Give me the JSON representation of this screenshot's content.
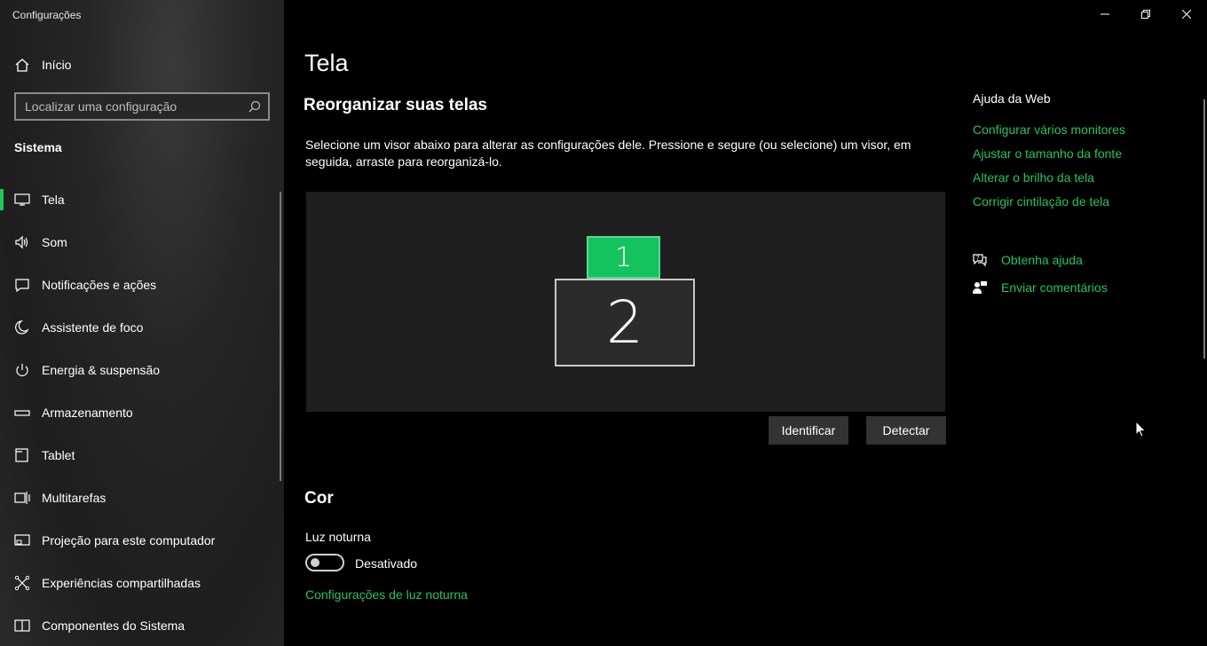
{
  "window": {
    "title": "Configurações",
    "controls": {
      "minimize": "minimize-icon",
      "maximize": "restore-icon",
      "close": "close-icon"
    }
  },
  "sidebar": {
    "home_label": "Início",
    "search_placeholder": "Localizar uma configuração",
    "section": "Sistema",
    "items": [
      {
        "label": "Tela",
        "icon": "monitor-icon",
        "active": true
      },
      {
        "label": "Som",
        "icon": "speaker-icon"
      },
      {
        "label": "Notificações e ações",
        "icon": "notification-icon"
      },
      {
        "label": "Assistente de foco",
        "icon": "moon-icon"
      },
      {
        "label": "Energia & suspensão",
        "icon": "power-icon"
      },
      {
        "label": "Armazenamento",
        "icon": "storage-icon"
      },
      {
        "label": "Tablet",
        "icon": "tablet-icon"
      },
      {
        "label": "Multitarefas",
        "icon": "multitasking-icon"
      },
      {
        "label": "Projeção para este computador",
        "icon": "projection-icon"
      },
      {
        "label": "Experiências compartilhadas",
        "icon": "shared-icon"
      },
      {
        "label": "Componentes do Sistema",
        "icon": "components-icon"
      }
    ]
  },
  "main": {
    "title": "Tela",
    "rearrange": {
      "heading": "Reorganizar suas telas",
      "description": "Selecione um visor abaixo para alterar as configurações dele. Pressione e segure (ou selecione) um visor, em seguida, arraste para reorganizá-lo.",
      "monitors": [
        "1",
        "2"
      ],
      "identify_button": "Identificar",
      "detect_button": "Detectar"
    },
    "color": {
      "heading": "Cor",
      "night_light_label": "Luz noturna",
      "night_light_state": "Desativado",
      "night_light_settings_link": "Configurações de luz noturna"
    }
  },
  "web_help": {
    "title": "Ajuda da Web",
    "links": [
      "Configurar vários monitores",
      "Ajustar o tamanho da fonte",
      "Alterar o brilho da tela",
      "Corrigir cintilação de tela"
    ],
    "get_help": "Obtenha ajuda",
    "send_feedback": "Enviar comentários"
  },
  "colors": {
    "accent": "#22c55e",
    "monitor_selected": "#14c35e",
    "background": "#000000",
    "sidebar": "#262626"
  }
}
